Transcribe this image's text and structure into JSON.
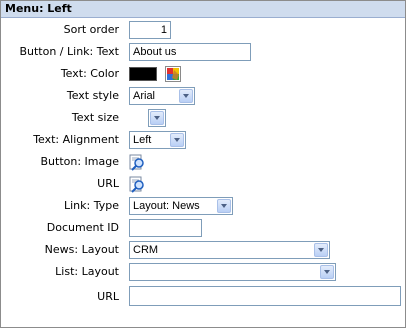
{
  "header": {
    "title": "Menu: Left"
  },
  "fields": {
    "sort_order": {
      "label": "Sort order",
      "value": "1"
    },
    "button_link_text": {
      "label": "Button / Link: Text",
      "value": "About us"
    },
    "text_color": {
      "label": "Text: Color",
      "color": "#000000",
      "icon": "color-palette-icon"
    },
    "text_style": {
      "label": "Text style",
      "value": "Arial"
    },
    "text_size": {
      "label": "Text size",
      "value": ""
    },
    "text_alignment": {
      "label": "Text: Alignment",
      "value": "Left"
    },
    "button_image": {
      "label": "Button: Image",
      "icon": "search-icon"
    },
    "url_1": {
      "label": "URL",
      "icon": "search-icon"
    },
    "link_type": {
      "label": "Link: Type",
      "value": "Layout: News"
    },
    "document_id": {
      "label": "Document ID",
      "value": ""
    },
    "news_layout": {
      "label": "News: Layout",
      "value": "CRM"
    },
    "list_layout": {
      "label": "List: Layout",
      "value": ""
    },
    "url_2": {
      "label": "URL",
      "value": ""
    }
  },
  "colors": {
    "header_bg": "#cfdcee",
    "input_border": "#7f9db9"
  }
}
